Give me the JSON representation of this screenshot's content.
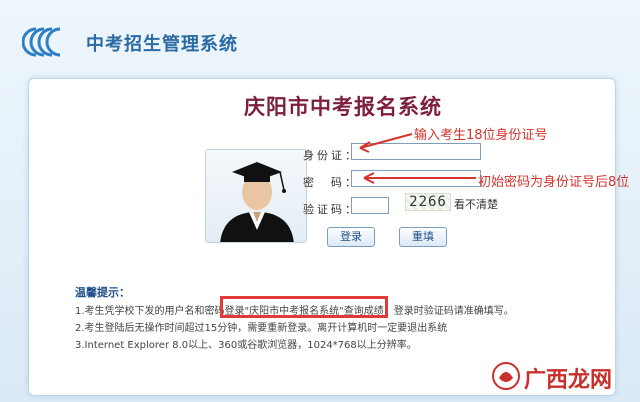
{
  "header": {
    "title": "中考招生管理系统"
  },
  "login": {
    "title": "庆阳市中考报名系统",
    "id_label": "身份证：",
    "id_value": "",
    "password_label": "密　码：",
    "password_value": "",
    "captcha_label": "验证码：",
    "captcha_value": "",
    "captcha_code": "2266",
    "captcha_unclear": "看不清楚",
    "login_button": "登录",
    "reset_button": "重填"
  },
  "annotations": {
    "id_hint": "输入考生18位身份证号",
    "password_hint": "初始密码为身份证号后8位"
  },
  "tips": {
    "title": "温馨提示：",
    "items": [
      "1.考生凭学校下发的用户名和密码登录\"庆阳市中考报名系统\"查询成绩，登录时验证码请准确填写。",
      "2.考生登陆后无操作时间超过15分钟，需要重新登录。离开计算机时一定要退出系统",
      "3.Internet Explorer 8.0以上、360或谷歌浏览器，1024*768以上分辨率。"
    ]
  },
  "watermark": "广西龙网",
  "colors": {
    "title_red": "#7d1f3c",
    "accent_blue": "#2b6aa3",
    "annotation_red": "#d6332d"
  }
}
